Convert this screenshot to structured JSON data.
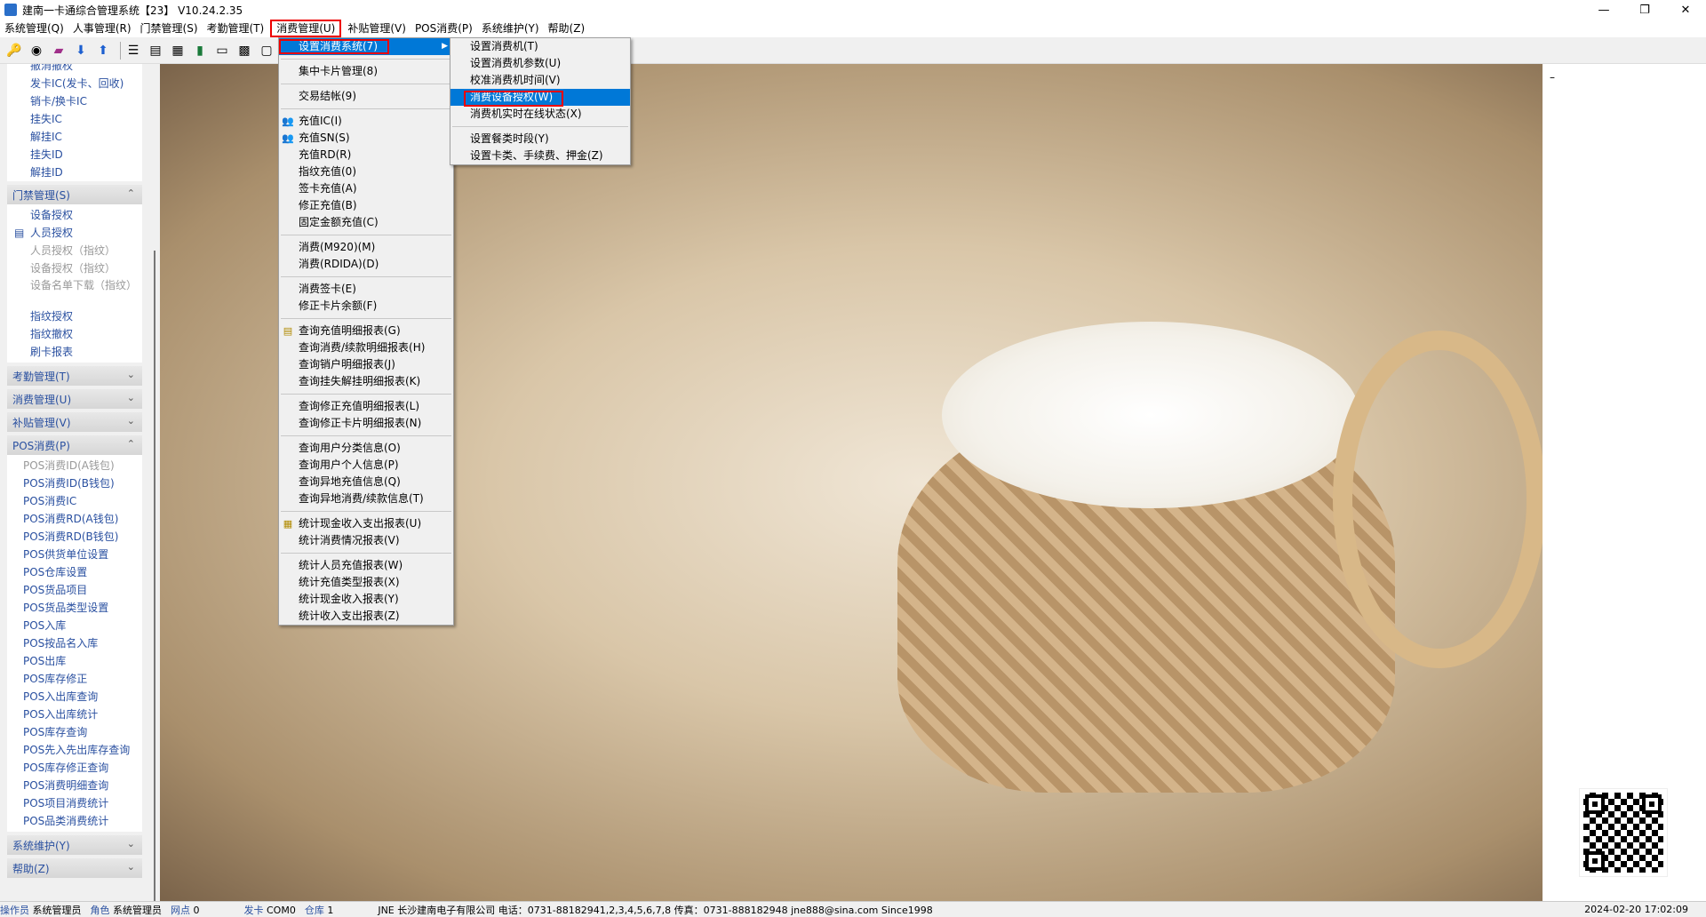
{
  "window": {
    "title": "建南一卡通综合管理系统【23】 V10.24.2.35",
    "minimize": "—",
    "maximize": "❐",
    "close": "✕"
  },
  "menubar": [
    "系统管理(Q)",
    "人事管理(R)",
    "门禁管理(S)",
    "考勤管理(T)",
    "消费管理(U)",
    "补贴管理(V)",
    "POS消费(P)",
    "系统维护(Y)",
    "帮助(Z)"
  ],
  "toolbar": {
    "icons": [
      "key-icon",
      "glasses-icon",
      "eraser-icon",
      "arrow-down-icon",
      "arrow-up-icon",
      "list-icon",
      "card-reader-icon",
      "report-icon",
      "device-icon",
      "chat-icon",
      "grid-icon",
      "window-icon"
    ]
  },
  "sidebar": {
    "top_items": [
      "撤消撤权",
      "发卡IC(发卡、回收)",
      "销卡/换卡IC",
      "挂失IC",
      "解挂IC",
      "挂失ID",
      "解挂ID"
    ],
    "groups": [
      {
        "label": "门禁管理(S)",
        "expanded": true,
        "items": [
          {
            "label": "设备授权",
            "disabled": false
          },
          {
            "label": "人员授权",
            "disabled": false,
            "icon": true
          },
          {
            "label": "人员授权（指纹）",
            "disabled": true
          },
          {
            "label": "设备授权（指纹）",
            "disabled": true
          },
          {
            "label": "设备名单下载（指纹）",
            "disabled": true,
            "tall": true
          },
          {
            "label": "指纹授权",
            "disabled": false
          },
          {
            "label": "指纹撤权",
            "disabled": false
          },
          {
            "label": "刷卡报表",
            "disabled": false
          }
        ]
      },
      {
        "label": "考勤管理(T)",
        "expanded": false,
        "items": []
      },
      {
        "label": "消费管理(U)",
        "expanded": false,
        "items": []
      },
      {
        "label": "补贴管理(V)",
        "expanded": false,
        "items": []
      },
      {
        "label": "POS消费(P)",
        "expanded": true,
        "items": [
          {
            "label": "POS消费ID(A钱包)",
            "disabled": true
          },
          {
            "label": "POS消费ID(B钱包)",
            "disabled": false
          },
          {
            "label": "POS消费IC",
            "disabled": false
          },
          {
            "label": "POS消费RD(A钱包)",
            "disabled": false
          },
          {
            "label": "POS消费RD(B钱包)",
            "disabled": false
          },
          {
            "label": "POS供货单位设置",
            "disabled": false
          },
          {
            "label": "POS仓库设置",
            "disabled": false
          },
          {
            "label": "POS货品项目",
            "disabled": false
          },
          {
            "label": "POS货品类型设置",
            "disabled": false
          },
          {
            "label": "POS入库",
            "disabled": false
          },
          {
            "label": "POS按品名入库",
            "disabled": false
          },
          {
            "label": "POS出库",
            "disabled": false
          },
          {
            "label": "POS库存修正",
            "disabled": false
          },
          {
            "label": "POS入出库查询",
            "disabled": false
          },
          {
            "label": "POS入出库统计",
            "disabled": false
          },
          {
            "label": "POS库存查询",
            "disabled": false
          },
          {
            "label": "POS先入先出库存查询",
            "disabled": false
          },
          {
            "label": "POS库存修正查询",
            "disabled": false
          },
          {
            "label": "POS消费明细查询",
            "disabled": false
          },
          {
            "label": "POS项目消费统计",
            "disabled": false
          },
          {
            "label": "POS品类消费统计",
            "disabled": false
          }
        ]
      },
      {
        "label": "系统维护(Y)",
        "expanded": false,
        "items": []
      },
      {
        "label": "帮助(Z)",
        "expanded": false,
        "items": []
      }
    ]
  },
  "consume_menu": [
    {
      "label": "设置消费系统(7)",
      "submenu": true,
      "selected": true
    },
    {
      "sep": true
    },
    {
      "label": "集中卡片管理(8)"
    },
    {
      "sep": true
    },
    {
      "label": "交易结帐(9)"
    },
    {
      "sep": true
    },
    {
      "label": "充值IC(I)",
      "icon": "users"
    },
    {
      "label": "充值SN(S)",
      "icon": "users"
    },
    {
      "label": "充值RD(R)"
    },
    {
      "label": "指纹充值(0)"
    },
    {
      "label": "签卡充值(A)"
    },
    {
      "label": "修正充值(B)"
    },
    {
      "label": "固定金额充值(C)"
    },
    {
      "sep": true
    },
    {
      "label": "消费(M920)(M)"
    },
    {
      "label": "消费(RDIDA)(D)"
    },
    {
      "sep": true
    },
    {
      "label": "消费签卡(E)"
    },
    {
      "label": "修正卡片余额(F)"
    },
    {
      "sep": true
    },
    {
      "label": "查询充值明细报表(G)",
      "icon": "report"
    },
    {
      "label": "查询消费/续款明细报表(H)"
    },
    {
      "label": "查询销户明细报表(J)"
    },
    {
      "label": "查询挂失解挂明细报表(K)"
    },
    {
      "sep": true
    },
    {
      "label": "查询修正充值明细报表(L)"
    },
    {
      "label": "查询修正卡片明细报表(N)"
    },
    {
      "sep": true
    },
    {
      "label": "查询用户分类信息(O)"
    },
    {
      "label": "查询用户个人信息(P)"
    },
    {
      "label": "查询异地充值信息(Q)"
    },
    {
      "label": "查询异地消费/续款信息(T)"
    },
    {
      "sep": true
    },
    {
      "label": "统计现金收入支出报表(U)",
      "icon": "calendar"
    },
    {
      "label": "统计消费情况报表(V)"
    },
    {
      "sep": true
    },
    {
      "label": "统计人员充值报表(W)"
    },
    {
      "label": "统计充值类型报表(X)"
    },
    {
      "label": "统计现金收入报表(Y)"
    },
    {
      "label": "统计收入支出报表(Z)"
    }
  ],
  "submenu": [
    {
      "label": "设置消费机(T)"
    },
    {
      "label": "设置消费机参数(U)"
    },
    {
      "label": "校准消费机时间(V)"
    },
    {
      "label": "消费设备授权(W)",
      "selected": true
    },
    {
      "label": "消费机实时在线状态(X)"
    },
    {
      "sep": true
    },
    {
      "label": "设置餐类时段(Y)"
    },
    {
      "label": "设置卡类、手续费、押金(Z)"
    }
  ],
  "rightpanel": {
    "marker": "–"
  },
  "statusbar": [
    {
      "k": "操作员",
      "v": "系统管理员"
    },
    {
      "k": "角色",
      "v": "系统管理员"
    },
    {
      "k": "网点",
      "v": "0"
    },
    {
      "k": "发卡",
      "v": "COM0"
    },
    {
      "k": "仓库",
      "v": "1"
    },
    {
      "k": "",
      "v": "JNE 长沙建南电子有限公司  电话：0731-88182941,2,3,4,5,6,7,8  传真：0731-888182948  jne888@sina.com  Since1998"
    },
    {
      "k": "",
      "v": "2024-02-20 17:02:09"
    }
  ]
}
